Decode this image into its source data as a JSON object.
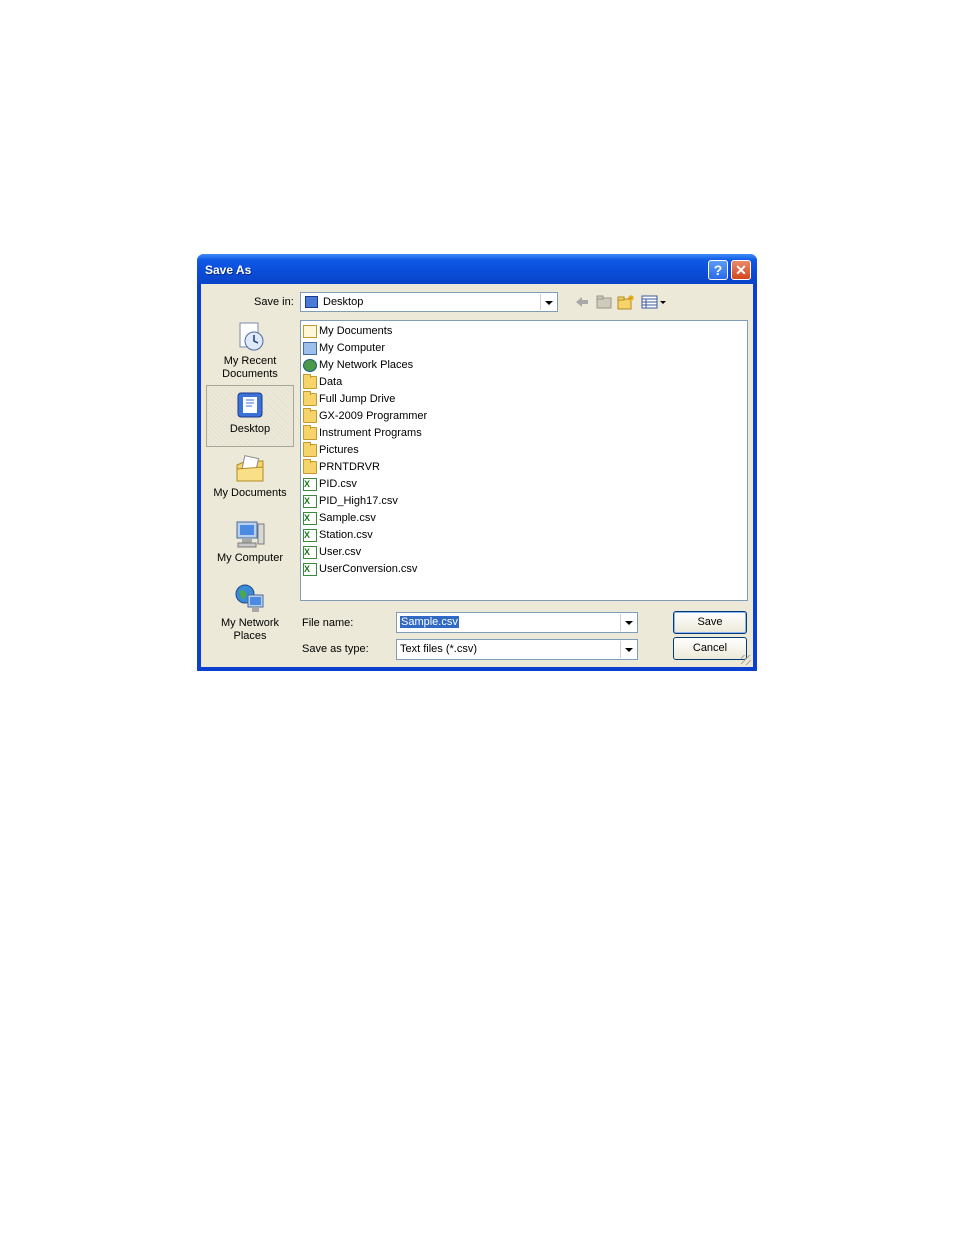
{
  "dialog": {
    "title": "Save As",
    "help_label": "?",
    "close_label": "✕"
  },
  "toolbar": {
    "save_in_label": "Save in:",
    "save_in_value": "Desktop"
  },
  "places": [
    {
      "label_line1": "My Recent",
      "label_line2": "Documents",
      "icon": "recent-documents-icon"
    },
    {
      "label_line1": "Desktop",
      "label_line2": "",
      "icon": "desktop-icon"
    },
    {
      "label_line1": "My Documents",
      "label_line2": "",
      "icon": "my-documents-icon"
    },
    {
      "label_line1": "My Computer",
      "label_line2": "",
      "icon": "my-computer-icon"
    },
    {
      "label_line1": "My Network",
      "label_line2": "Places",
      "icon": "network-places-icon"
    }
  ],
  "files": [
    {
      "name": "My Documents",
      "kind": "doc"
    },
    {
      "name": "My Computer",
      "kind": "comp"
    },
    {
      "name": "My Network Places",
      "kind": "net"
    },
    {
      "name": "Data",
      "kind": "folder"
    },
    {
      "name": "Full Jump Drive",
      "kind": "folder"
    },
    {
      "name": "GX-2009 Programmer",
      "kind": "folder"
    },
    {
      "name": "Instrument Programs",
      "kind": "folder"
    },
    {
      "name": "Pictures",
      "kind": "folder"
    },
    {
      "name": "PRNTDRVR",
      "kind": "folder"
    },
    {
      "name": "PID.csv",
      "kind": "csv"
    },
    {
      "name": "PID_High17.csv",
      "kind": "csv"
    },
    {
      "name": "Sample.csv",
      "kind": "csv"
    },
    {
      "name": "Station.csv",
      "kind": "csv"
    },
    {
      "name": "User.csv",
      "kind": "csv"
    },
    {
      "name": "UserConversion.csv",
      "kind": "csv"
    }
  ],
  "form": {
    "file_name_label": "File name:",
    "file_name_value": "Sample.csv",
    "save_type_label": "Save as type:",
    "save_type_value": "Text files (*.csv)",
    "save_button": "Save",
    "cancel_button": "Cancel"
  }
}
